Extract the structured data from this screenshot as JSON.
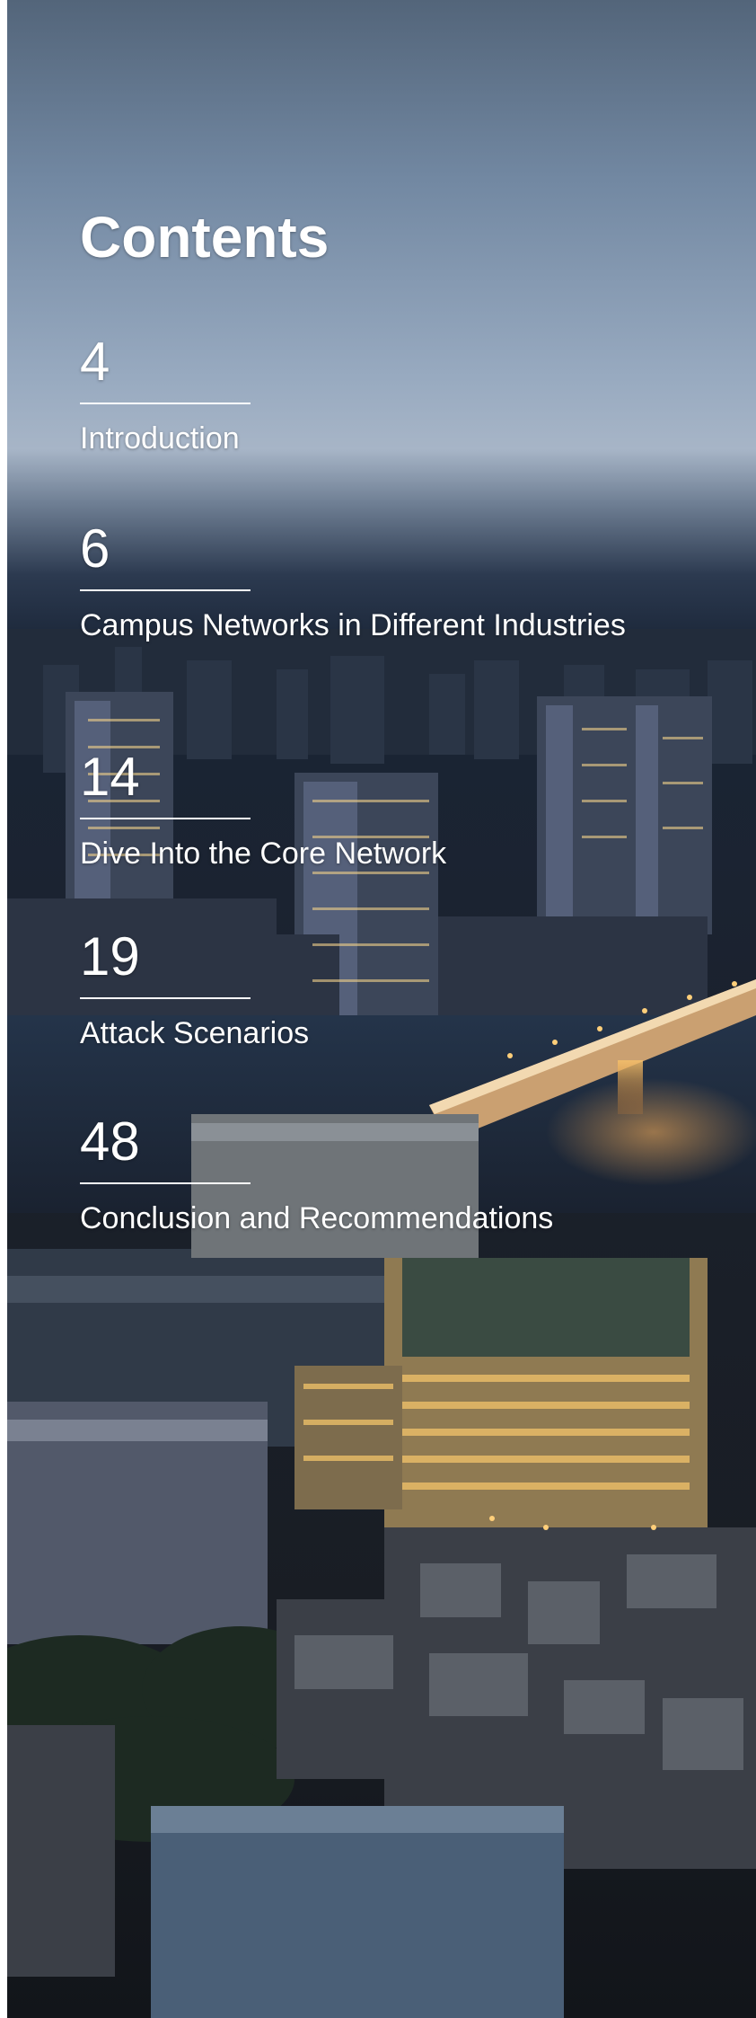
{
  "contents": {
    "title": "Contents",
    "entries": [
      {
        "page": "4",
        "title": "Introduction"
      },
      {
        "page": "6",
        "title": "Campus Networks in Different Industries"
      },
      {
        "page": "14",
        "title": "Dive Into the Core Network"
      },
      {
        "page": "19",
        "title": "Attack Scenarios"
      },
      {
        "page": "48",
        "title": "Conclusion and Recommendations"
      }
    ]
  },
  "colors": {
    "text": "#ffffff",
    "sky_top": "#53657a",
    "city_dark": "#1a202a",
    "light_warm": "#f3c46a"
  }
}
